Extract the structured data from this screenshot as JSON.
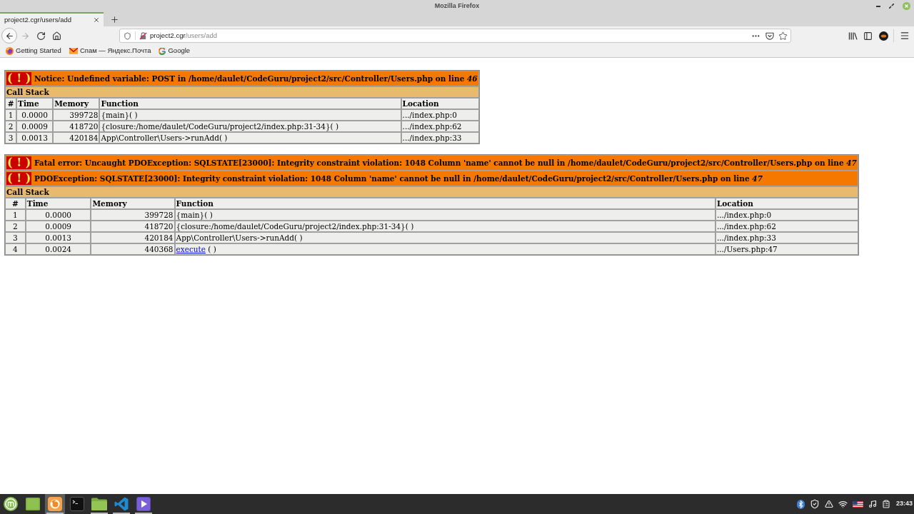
{
  "window": {
    "title": "Mozilla Firefox"
  },
  "tabs": [
    {
      "label": "project2.cgr/users/add",
      "selected": true
    }
  ],
  "nav_buttons": [
    {
      "kind": "back",
      "disabled": false
    },
    {
      "kind": "forward",
      "disabled": true
    },
    {
      "kind": "reload",
      "disabled": false
    },
    {
      "kind": "home",
      "disabled": false
    }
  ],
  "address_bar": {
    "host": "project2.cgr",
    "path": "/users/add"
  },
  "bookmarks": [
    {
      "kind": "firefox",
      "label": "Getting Started"
    },
    {
      "kind": "mail",
      "label": "Спам — Яндекс.Почта"
    },
    {
      "kind": "google",
      "label": "Google"
    }
  ],
  "error_tables": [
    {
      "messages": [
        {
          "badge": "( ! )",
          "text": "Notice: Undefined variable: POST in /home/daulet/CodeGuru/project2/src/Controller/Users.php on line *46*"
        }
      ],
      "call_stack_title": "Call Stack",
      "columns": [
        "#",
        "Time",
        "Memory",
        "Function",
        "Location"
      ],
      "rows": [
        {
          "number": "1",
          "time": "0.0000",
          "memory": "399728",
          "function": "{main}( )",
          "location": ".../index.php:0"
        },
        {
          "number": "2",
          "time": "0.0009",
          "memory": "418720",
          "function": "{closure:/home/daulet/CodeGuru/project2/index.php:31-34}( )",
          "location": ".../index.php:62"
        },
        {
          "number": "3",
          "time": "0.0013",
          "memory": "420184",
          "function": "App\\Controller\\Users->runAdd( )",
          "location": ".../index.php:33"
        }
      ]
    },
    {
      "messages": [
        {
          "badge": "( ! )",
          "text": "Fatal error: Uncaught PDOException: SQLSTATE[23000]: Integrity constraint violation: 1048 Column 'name' cannot be null in /home/daulet/CodeGuru/project2/src/Controller/Users.php on line *47*"
        },
        {
          "badge": "( ! )",
          "text": "PDOException: SQLSTATE[23000]: Integrity constraint violation: 1048 Column 'name' cannot be null in /home/daulet/CodeGuru/project2/src/Controller/Users.php on line *47*"
        }
      ],
      "call_stack_title": "Call Stack",
      "columns": [
        "#",
        "Time",
        "Memory",
        "Function",
        "Location"
      ],
      "rows": [
        {
          "number": "1",
          "time": "0.0000",
          "memory": "399728",
          "function": "{main}( )",
          "location": ".../index.php:0"
        },
        {
          "number": "2",
          "time": "0.0009",
          "memory": "418720",
          "function": "{closure:/home/daulet/CodeGuru/project2/index.php:31-34}( )",
          "location": ".../index.php:62"
        },
        {
          "number": "3",
          "time": "0.0013",
          "memory": "420184",
          "function": "App\\Controller\\Users->runAdd( )",
          "location": ".../index.php:33"
        },
        {
          "number": "4",
          "time": "0.0024",
          "memory": "440368",
          "function_link": "execute",
          "function": "( )",
          "location": ".../Users.php:47"
        }
      ]
    }
  ],
  "taskbar": {
    "apps": [
      {
        "kind": "start-menu",
        "active": false,
        "running": false
      },
      {
        "kind": "desktop",
        "active": false,
        "running": false
      },
      {
        "kind": "firefox",
        "active": true,
        "running": true
      },
      {
        "kind": "terminal",
        "active": false,
        "running": false
      },
      {
        "kind": "files",
        "active": false,
        "running": true
      },
      {
        "kind": "vscode",
        "active": false,
        "running": true
      },
      {
        "kind": "player",
        "active": false,
        "running": true
      }
    ],
    "clock": "23:43"
  }
}
